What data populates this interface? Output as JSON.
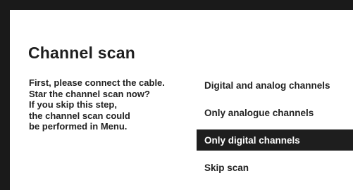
{
  "dialog": {
    "title": "Channel scan",
    "message_lines": [
      "First, please connect the cable.",
      "Star the channel scan now?",
      "If you skip this step,",
      "the channel scan could",
      "be performed in Menu."
    ]
  },
  "options": [
    {
      "label": "Digital and analog channels",
      "selected": false
    },
    {
      "label": "Only analogue channels",
      "selected": false
    },
    {
      "label": "Only digital channels",
      "selected": true
    },
    {
      "label": "Skip scan",
      "selected": false
    }
  ],
  "colors": {
    "background_frame": "#1a1a1a",
    "panel": "#ffffff",
    "text": "#222222",
    "selected_background": "#1e1e1e",
    "selected_text": "#ffffff"
  }
}
